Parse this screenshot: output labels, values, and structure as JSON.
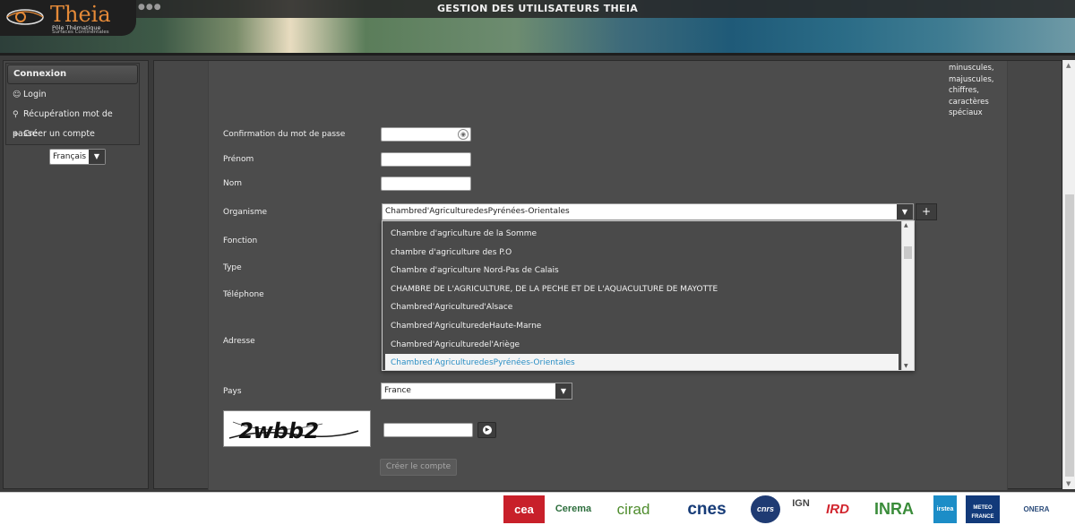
{
  "header": {
    "title": "GESTION DES UTILISATEURS THEIA",
    "logo_name": "Theia",
    "logo_line1": "Pôle Thématique",
    "logo_line2": "Surfaces Continentales"
  },
  "sidebar": {
    "heading": "Connexion",
    "items": [
      {
        "label": "Login",
        "icon": "user-icon"
      },
      {
        "label": "Récupération mot de passe",
        "icon": "key-icon"
      },
      {
        "label": "Créer un compte",
        "icon": "plus-icon"
      }
    ],
    "language": "Français"
  },
  "form": {
    "password_hint": [
      "minuscules,",
      "majuscules,",
      "chiffres,",
      "caractères",
      "spéciaux"
    ],
    "labels": {
      "confirm_password": "Confirmation du mot de passe",
      "firstname": "Prénom",
      "lastname": "Nom",
      "organisation": "Organisme",
      "fonction": "Fonction",
      "type": "Type",
      "phone": "Téléphone",
      "address": "Adresse",
      "country": "Pays"
    },
    "organisation_value": "Chambred'AgriculturedesPyrénées-Orientales",
    "country_value": "France",
    "create_button": "Créer le compte"
  },
  "organisation_dropdown": {
    "options": [
      "Chambre d'agriculture de la Somme",
      "chambre d'agriculture des P.O",
      "Chambre d'agriculture Nord-Pas de Calais",
      "CHAMBRE DE L'AGRICULTURE, DE LA PECHE ET DE L'AQUACULTURE DE MAYOTTE",
      "Chambred'Agricultured'Alsace",
      "Chambred'AgriculturedeHaute-Marne",
      "Chambred'Agriculturedel'Ariège",
      "Chambred'AgriculturedesPyrénées-Orientales"
    ],
    "selected_index": 7
  },
  "captcha_text": "2wbb2",
  "partners": [
    "cea",
    "Cerema",
    "cirad",
    "cnes",
    "cnrs",
    "IGN",
    "IRD",
    "INRA",
    "irstea",
    "METEO FRANCE",
    "ONERA"
  ]
}
